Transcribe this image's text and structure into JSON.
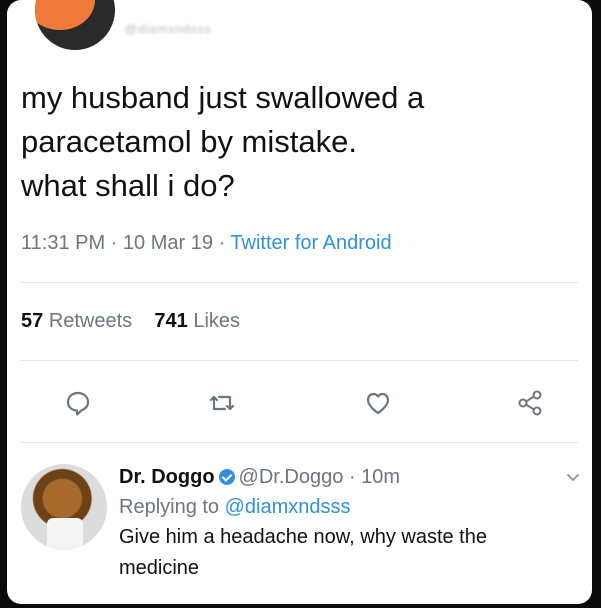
{
  "tweet": {
    "handle": "@diamxndsss",
    "text": "my husband just swallowed a\nparacetamol by mistake.\nwhat shall i do?",
    "time": "11:31 PM",
    "date": "10 Mar 19",
    "source": "Twitter for Android",
    "retweets_count": "57",
    "retweets_label": "Retweets",
    "likes_count": "741",
    "likes_label": "Likes"
  },
  "actions": [
    {
      "name": "reply-icon"
    },
    {
      "name": "retweet-icon"
    },
    {
      "name": "like-icon"
    },
    {
      "name": "share-icon"
    }
  ],
  "reply": {
    "name": "Dr. Doggo",
    "handle": "@Dr.Doggo",
    "time": "10m",
    "replying_prefix": "Replying to",
    "replying_to": "@diamxndsss",
    "text": "Give him a headache now, why waste the medicine"
  },
  "colors": {
    "link": "#2f8fe0",
    "muted": "#6a7681",
    "text": "#111111"
  }
}
